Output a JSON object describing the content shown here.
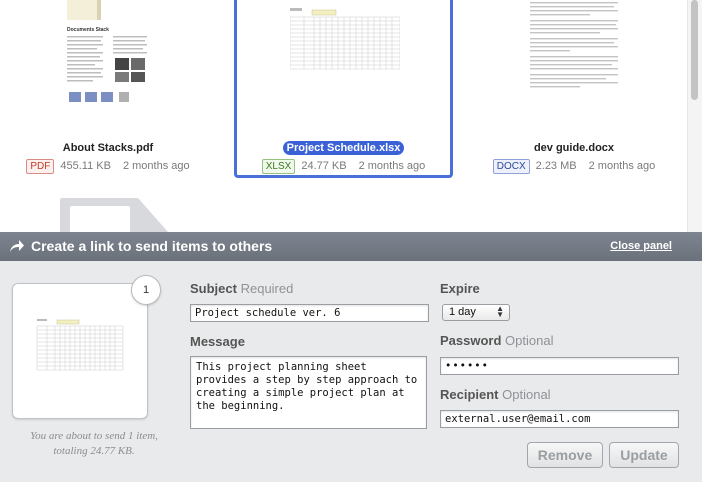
{
  "files": [
    {
      "name": "About Stacks.pdf",
      "type": "PDF",
      "size": "455.11 KB",
      "modified": "2 months ago",
      "selected": false,
      "doc_title": "Documents Stack"
    },
    {
      "name": "Project Schedule.xlsx",
      "type": "XLSX",
      "size": "24.77 KB",
      "modified": "2 months ago",
      "selected": true
    },
    {
      "name": "dev guide.docx",
      "type": "DOCX",
      "size": "2.23 MB",
      "modified": "2 months ago",
      "selected": false
    }
  ],
  "panel": {
    "title": "Create a link to send items to others",
    "close_label": "Close panel",
    "item_count": "1",
    "preview_note": "You are about to send 1 item, totaling 24.77 KB.",
    "subject": {
      "label": "Subject",
      "hint": "Required",
      "value": "Project schedule ver. 6"
    },
    "message": {
      "label": "Message",
      "value": "This project planning sheet provides a step by step approach to creating a simple project plan at the beginning."
    },
    "expire": {
      "label": "Expire",
      "value": "1 day"
    },
    "password": {
      "label": "Password",
      "hint": "Optional",
      "value": "••••••"
    },
    "recipient": {
      "label": "Recipient",
      "hint": "Optional",
      "value": "external.user@email.com"
    },
    "remove_label": "Remove",
    "update_label": "Update"
  },
  "colors": {
    "selection": "#3a62d6",
    "header": "#737a84",
    "panel_bg": "#e9eaeb"
  },
  "icons": [
    "share-arrow-icon",
    "select-arrows-icon"
  ]
}
